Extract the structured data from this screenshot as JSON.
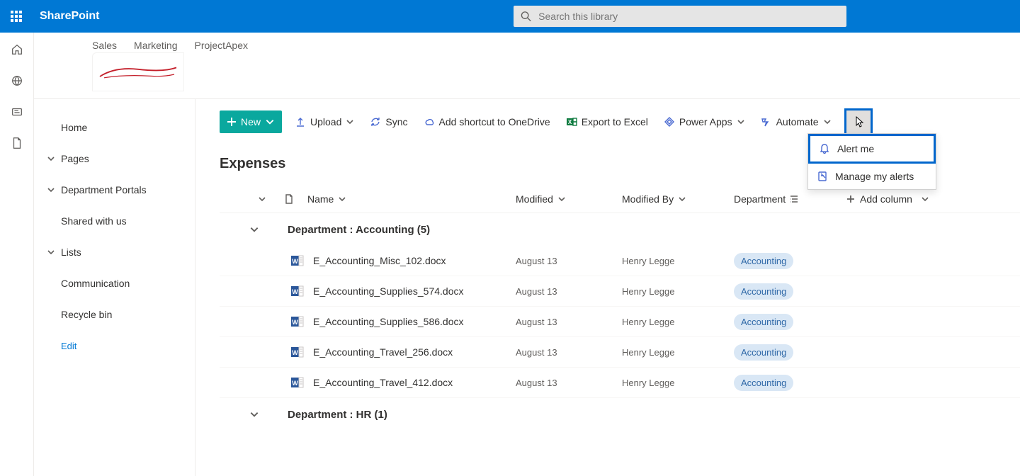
{
  "suite": {
    "brand": "SharePoint"
  },
  "search": {
    "placeholder": "Search this library"
  },
  "hubnav": {
    "items": [
      "Sales",
      "Marketing",
      "ProjectApex"
    ]
  },
  "sitenav": {
    "items": [
      {
        "label": "Home",
        "chevron": false
      },
      {
        "label": "Pages",
        "chevron": true
      },
      {
        "label": "Department Portals",
        "chevron": true
      },
      {
        "label": "Shared with us",
        "chevron": false
      },
      {
        "label": "Lists",
        "chevron": true
      },
      {
        "label": "Communication",
        "chevron": false
      },
      {
        "label": "Recycle bin",
        "chevron": false
      }
    ],
    "edit": "Edit"
  },
  "commandbar": {
    "new": "New",
    "upload": "Upload",
    "sync": "Sync",
    "addshortcut": "Add shortcut to OneDrive",
    "export": "Export to Excel",
    "powerapps": "Power Apps",
    "automate": "Automate"
  },
  "dropdown": {
    "alert": "Alert me",
    "manage": "Manage my alerts"
  },
  "library": {
    "title": "Expenses"
  },
  "columns": {
    "name": "Name",
    "modified": "Modified",
    "modifiedby": "Modified By",
    "department": "Department",
    "addcolumn": "Add column"
  },
  "groups": [
    {
      "label": "Department : Accounting (5)",
      "rows": [
        {
          "name": "E_Accounting_Misc_102.docx",
          "modified": "August 13",
          "by": "Henry Legge",
          "dept": "Accounting"
        },
        {
          "name": "E_Accounting_Supplies_574.docx",
          "modified": "August 13",
          "by": "Henry Legge",
          "dept": "Accounting"
        },
        {
          "name": "E_Accounting_Supplies_586.docx",
          "modified": "August 13",
          "by": "Henry Legge",
          "dept": "Accounting"
        },
        {
          "name": "E_Accounting_Travel_256.docx",
          "modified": "August 13",
          "by": "Henry Legge",
          "dept": "Accounting"
        },
        {
          "name": "E_Accounting_Travel_412.docx",
          "modified": "August 13",
          "by": "Henry Legge",
          "dept": "Accounting"
        }
      ]
    },
    {
      "label": "Department : HR (1)",
      "rows": []
    }
  ]
}
